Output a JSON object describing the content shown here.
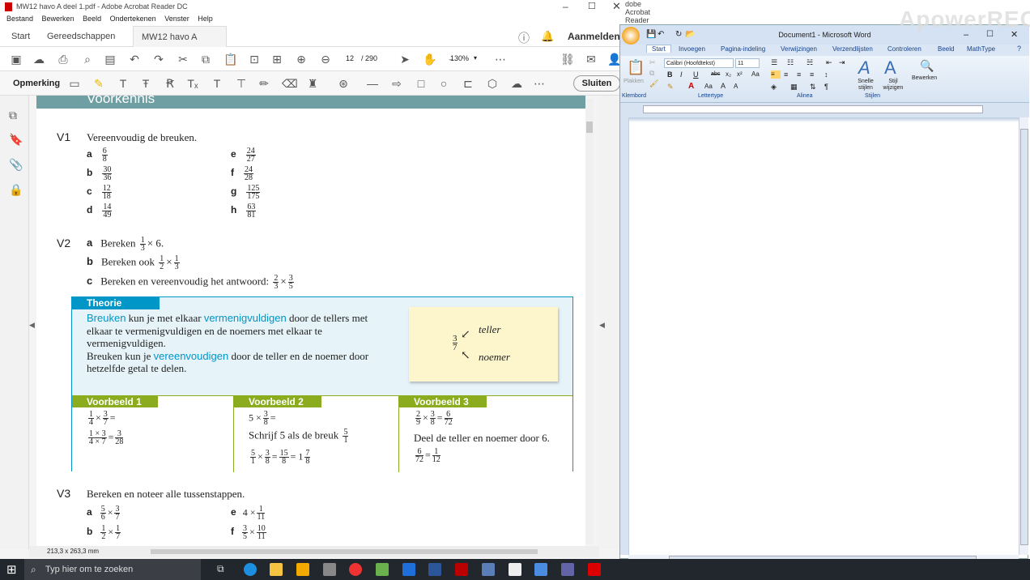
{
  "acrobat": {
    "title": "MW12 havo A deel 1.pdf - Adobe Acrobat Reader DC",
    "menu": [
      "Bestand",
      "Bewerken",
      "Beeld",
      "Ondertekenen",
      "Venster",
      "Help"
    ],
    "tabs": {
      "start": "Start",
      "tools": "Gereedschappen",
      "doc": "MW12 havo A deel..."
    },
    "signin": "Aanmelden",
    "page_current": "12",
    "page_total": "/ 290",
    "zoom": "130%",
    "comment_label": "Opmerking",
    "close_label": "Sluiten",
    "status_size": "213,3 x 263,3 mm",
    "second_window_title": "dobe Acrobat Reader DC",
    "second_window_menu": [
      "rtekenen",
      "Venster",
      "Help"
    ]
  },
  "content": {
    "header": "Voorkennis",
    "v1": {
      "num": "V1",
      "text": "Vereenvoudig de breuken.",
      "items": [
        {
          "l": "a",
          "n": "6",
          "d": "8"
        },
        {
          "l": "b",
          "n": "30",
          "d": "36"
        },
        {
          "l": "c",
          "n": "12",
          "d": "18"
        },
        {
          "l": "d",
          "n": "14",
          "d": "49"
        },
        {
          "l": "e",
          "n": "24",
          "d": "27"
        },
        {
          "l": "f",
          "n": "24",
          "d": "28"
        },
        {
          "l": "g",
          "n": "125",
          "d": "175"
        },
        {
          "l": "h",
          "n": "63",
          "d": "81"
        }
      ]
    },
    "v2": {
      "num": "V2",
      "a": "Bereken",
      "a_tail": "× 6.",
      "b": "Bereken ook",
      "c": "Bereken en vereenvoudig het antwoord:"
    },
    "theorie": {
      "label": "Theorie",
      "p1a": "Breuken",
      "p1b": " kun je met elkaar ",
      "p1c": "vermenigvuldigen",
      "p1d": " door de tellers met elkaar te vermenigvuldigen en de noemers met elkaar te vermenigvuldigen.",
      "p2a": "Breuken kun je ",
      "p2b": "vereenvoudigen",
      "p2c": " door de teller en de noemer door hetzelfde getal te delen.",
      "note_teller": "teller",
      "note_noemer": "noemer"
    },
    "examples": [
      {
        "label": "Voorbeeld 1",
        "text": ""
      },
      {
        "label": "Voorbeeld 2",
        "text": "Schrijf 5 als de breuk"
      },
      {
        "label": "Voorbeeld 3",
        "text": "Deel de teller en noemer door 6."
      }
    ],
    "v3": {
      "num": "V3",
      "text": "Bereken en noteer alle tussenstappen."
    }
  },
  "word": {
    "title": "Document1 - Microsoft Word",
    "tabs": [
      "Start",
      "Invoegen",
      "Pagina-indeling",
      "Verwijzingen",
      "Verzendlijsten",
      "Controleren",
      "Beeld",
      "MathType"
    ],
    "font": "Calibri (Hoofdtekst)",
    "size": "11",
    "groups": [
      "Klembord",
      "Lettertype",
      "Alinea",
      "Stijlen"
    ],
    "paste": "Plakken",
    "styles_quick": "Snelle stijlen",
    "styles_change": "Stijl wijzigen",
    "edit": "Bewerken"
  },
  "taskbar": {
    "search_placeholder": "Typ hier om te zoeken"
  },
  "watermark": "ApowerREC",
  "colors": {
    "teal": "#0096c8",
    "green": "#8aac1e",
    "header_bar": "#6f9ea3",
    "note": "#fdf6cc",
    "theory_bg": "#e6f3f9"
  }
}
